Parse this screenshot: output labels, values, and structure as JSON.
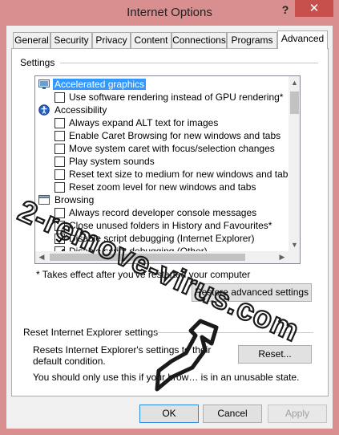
{
  "window": {
    "title": "Internet Options",
    "help_label": "?",
    "close_label": "✕"
  },
  "tabs": [
    {
      "label": "General"
    },
    {
      "label": "Security"
    },
    {
      "label": "Privacy"
    },
    {
      "label": "Content"
    },
    {
      "label": "Connections"
    },
    {
      "label": "Programs"
    },
    {
      "label": "Advanced",
      "active": true
    }
  ],
  "settings": {
    "label": "Settings",
    "items": [
      {
        "type": "category",
        "label": "Accelerated graphics",
        "icon": "monitor-icon",
        "selected": true
      },
      {
        "type": "checkbox",
        "label": "Use software rendering instead of GPU rendering*",
        "checked": false
      },
      {
        "type": "category",
        "label": "Accessibility",
        "icon": "accessibility-icon"
      },
      {
        "type": "checkbox",
        "label": "Always expand ALT text for images",
        "checked": false
      },
      {
        "type": "checkbox",
        "label": "Enable Caret Browsing for new windows and tabs",
        "checked": false
      },
      {
        "type": "checkbox",
        "label": "Move system caret with focus/selection changes",
        "checked": false
      },
      {
        "type": "checkbox",
        "label": "Play system sounds",
        "checked": false
      },
      {
        "type": "checkbox",
        "label": "Reset text size to medium for new windows and tabs",
        "checked": false
      },
      {
        "type": "checkbox",
        "label": "Reset zoom level for new windows and tabs",
        "checked": false
      },
      {
        "type": "category",
        "label": "Browsing",
        "icon": "browsing-icon"
      },
      {
        "type": "checkbox",
        "label": "Always record developer console messages",
        "checked": false
      },
      {
        "type": "checkbox",
        "label": "Close unused folders in History and Favourites*",
        "checked": false
      },
      {
        "type": "checkbox",
        "label": "Disable script debugging (Internet Explorer)",
        "checked": true
      },
      {
        "type": "checkbox",
        "label": "Disable script debugging (Other)",
        "checked": true
      }
    ],
    "note": "* Takes effect after you've restarted your computer",
    "restore_label": "Restore advanced settings"
  },
  "reset": {
    "label": "Reset Internet Explorer settings",
    "description": "Resets Internet Explorer's settings to their default condition.",
    "button_label": "Reset...",
    "warning": "You should only use this if your brow… is in an unusable state."
  },
  "footer": {
    "ok_label": "OK",
    "cancel_label": "Cancel",
    "apply_label": "Apply"
  },
  "watermark": {
    "text": "2-remove-virus.com"
  },
  "colors": {
    "window_frame": "#d98f8f",
    "close_button": "#c7504c",
    "selection": "#3399ff",
    "default_button_border": "#2b8bd8",
    "watermark": "#1a1a1a"
  }
}
